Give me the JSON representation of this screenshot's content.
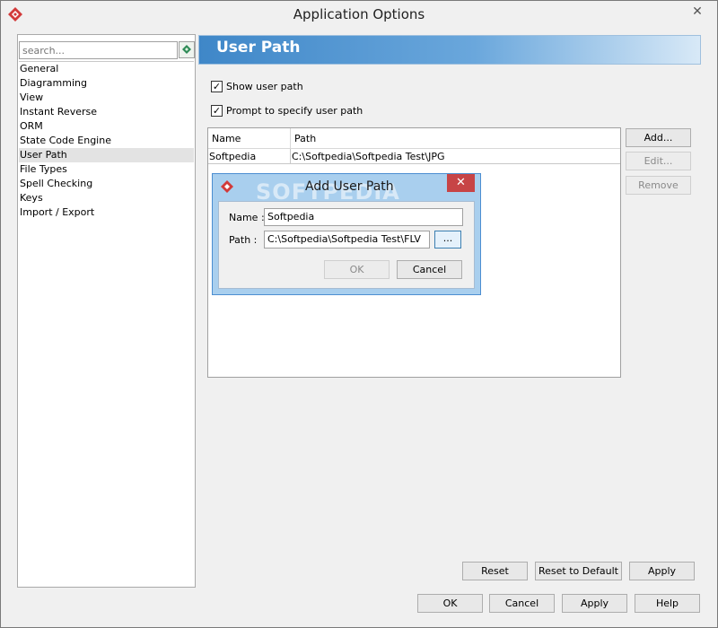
{
  "window": {
    "title": "Application Options",
    "close_glyph": "✕"
  },
  "sidebar": {
    "search_placeholder": "search...",
    "items": [
      {
        "label": "General"
      },
      {
        "label": "Diagramming"
      },
      {
        "label": "View"
      },
      {
        "label": "Instant Reverse"
      },
      {
        "label": "ORM"
      },
      {
        "label": "State Code Engine"
      },
      {
        "label": "User Path",
        "selected": true
      },
      {
        "label": "File Types"
      },
      {
        "label": "Spell Checking"
      },
      {
        "label": "Keys"
      },
      {
        "label": "Import / Export"
      }
    ]
  },
  "panel": {
    "title": "User Path",
    "show_user_path": {
      "label": "Show user path",
      "checked": true
    },
    "prompt_path": {
      "label": "Prompt to specify user path",
      "checked": true
    },
    "table": {
      "columns": [
        "Name",
        "Path"
      ],
      "rows": [
        {
          "name": "Softpedia",
          "path": "C:\\Softpedia\\Softpedia Test\\JPG"
        }
      ]
    },
    "buttons": {
      "add": "Add...",
      "edit": "Edit...",
      "remove": "Remove"
    }
  },
  "dialog": {
    "title": "Add User Path",
    "close_glyph": "✕",
    "name_label": "Name :",
    "name_value": "Softpedia",
    "path_label": "Path :",
    "path_value": "C:\\Softpedia\\Softpedia Test\\FLV",
    "browse": "...",
    "ok": "OK",
    "cancel": "Cancel"
  },
  "panel_footer": {
    "reset": "Reset",
    "reset_default": "Reset to Default",
    "apply": "Apply"
  },
  "footer": {
    "ok": "OK",
    "cancel": "Cancel",
    "apply": "Apply",
    "help": "Help"
  },
  "watermark": "SOFTPEDIA",
  "colors": {
    "accent": "#3f87c8",
    "dialog_close": "#c74446"
  }
}
